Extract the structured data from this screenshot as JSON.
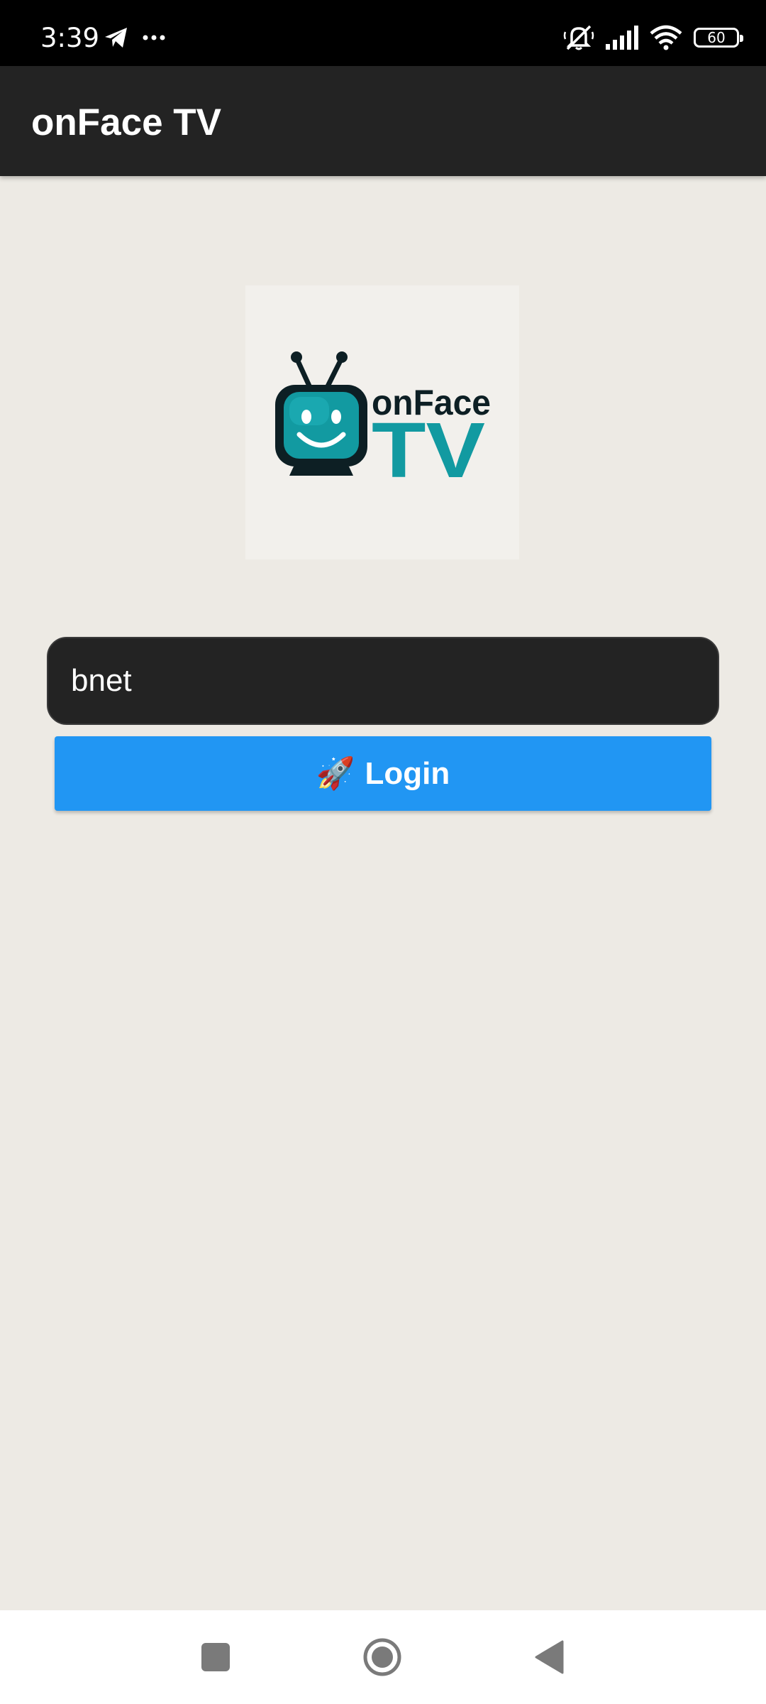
{
  "status_bar": {
    "time": "3:39",
    "left_icons": [
      "telegram-icon",
      "more-dots-icon"
    ],
    "right_icons": [
      "silent-bell-icon",
      "signal-icon",
      "wifi-icon"
    ],
    "battery_level": "60"
  },
  "app_bar": {
    "title": "onFace TV"
  },
  "logo": {
    "text_top": "onFace",
    "text_bottom": "TV",
    "teal": "#129aa1",
    "dark": "#0d1f24"
  },
  "server_input": {
    "value": "bnet"
  },
  "login_button": {
    "icon": "🚀",
    "label": "Login",
    "color": "#2196f3"
  },
  "nav_bar": {
    "buttons": [
      "recents-square-icon",
      "home-circle-icon",
      "back-triangle-icon"
    ]
  }
}
